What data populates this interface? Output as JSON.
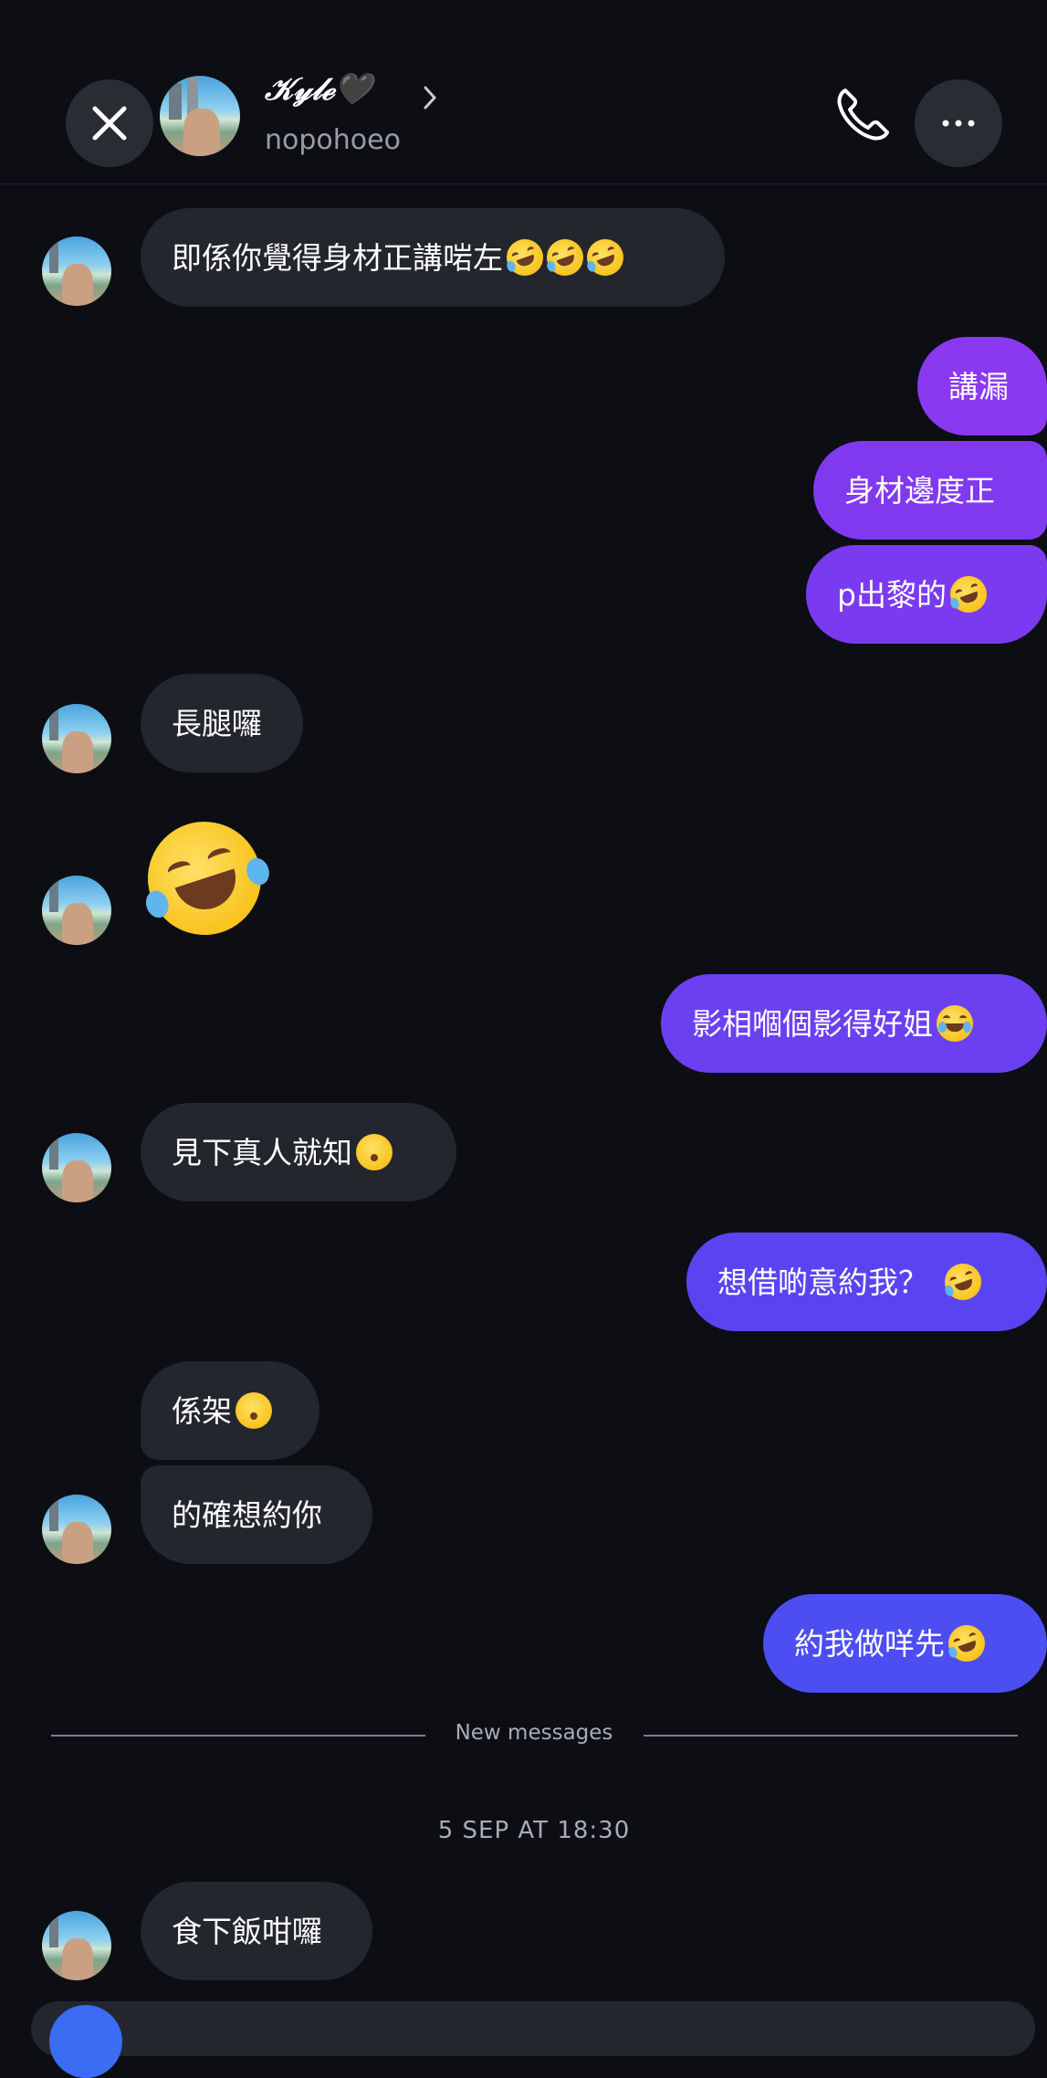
{
  "header": {
    "display_name": "𝒦𝓎𝓁ℯ🖤",
    "username": "nopohoeo",
    "close_icon": "close-icon",
    "call_icon": "phone-icon",
    "more_icon": "more-icon"
  },
  "messages": [
    {
      "side": "in",
      "text": "即係你覺得身材正講啱左",
      "emoji": [
        "rofl",
        "rofl",
        "rofl"
      ]
    },
    {
      "side": "out",
      "text": "講漏"
    },
    {
      "side": "out",
      "text": "身材邊度正"
    },
    {
      "side": "out",
      "text": "p出黎的",
      "emoji": [
        "rofl"
      ]
    },
    {
      "side": "in",
      "text": "長腿囉"
    },
    {
      "side": "in",
      "text": "",
      "emoji": [
        "rofl-large"
      ]
    },
    {
      "side": "out",
      "text": "影相嗰個影得好姐",
      "emoji": [
        "joy-cat"
      ]
    },
    {
      "side": "in",
      "text": "見下真人就知",
      "emoji": [
        "kissing"
      ]
    },
    {
      "side": "out",
      "text": "想借啲意約我？",
      "emoji": [
        "rofl"
      ]
    },
    {
      "side": "in",
      "text": "係架",
      "emoji": [
        "kissing"
      ]
    },
    {
      "side": "in",
      "text": "的確想約你"
    },
    {
      "side": "out",
      "text": "約我做咩先",
      "emoji": [
        "rofl"
      ]
    },
    {
      "side": "in",
      "text": "食下飯咁囉"
    }
  ],
  "divider": {
    "label": "New messages"
  },
  "timestamp": "5 SEP AT 18:30",
  "colors": {
    "background": "#0c0e14",
    "incoming": "#24262d",
    "outgoing_purple": "#8a3cf0",
    "outgoing_blue": "#4b4ff2"
  }
}
